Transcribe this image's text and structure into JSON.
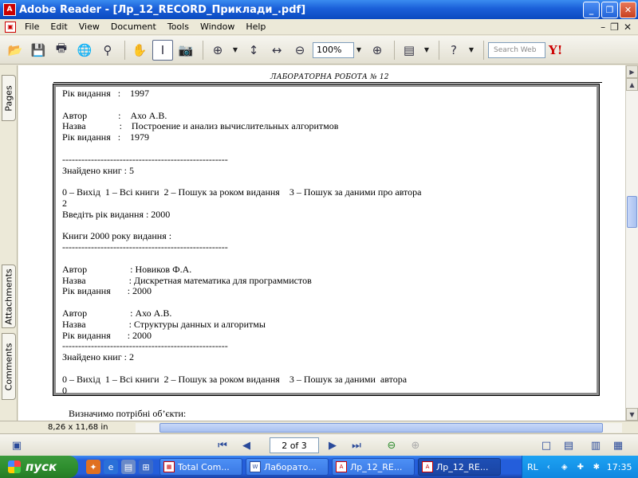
{
  "window": {
    "app_title": "Adobe Reader",
    "title_separator": " - ",
    "document_title": "[Лр_12_RECORD_Приклади_.pdf]",
    "min_label": "_",
    "max_label": "❐",
    "close_label": "✕"
  },
  "menu": {
    "items": [
      "File",
      "Edit",
      "View",
      "Document",
      "Tools",
      "Window",
      "Help"
    ]
  },
  "toolbar": {
    "zoom_value": "100%",
    "search_placeholder": "Search Web",
    "yahoo_label": "Y!"
  },
  "nav_pane": {
    "tabs": [
      "Pages",
      "Attachments",
      "Comments"
    ]
  },
  "document": {
    "page_header": "ЛАБОРАТОРНА РОБОТА № 12",
    "console_lines": [
      "Рік видання   :    1997",
      "",
      "Автор             :    Ахо А.В.",
      "Назва              :    Построение и анализ вычислительных алгоритмов",
      "Рік видання   :    1979",
      "",
      "----------------------------------------------------",
      "Знайдено книг : 5",
      "",
      "0 – Вихід  1 – Всі книги  2 – Пошук за роком видання    3 – Пошук за даними про автора",
      "2",
      "Введіть рік видання : 2000",
      "",
      "Книги 2000 року видання :",
      "----------------------------------------------------",
      "",
      "Автор                  : Новиков Ф.А.",
      "Назва                  : Дискретная математика для программистов",
      "Рік видання       : 2000",
      "",
      "Автор                  : Ахо А.В.",
      "Назва                  : Структуры данных и алгоритмы",
      "Рік видання       : 2000",
      "----------------------------------------------------",
      "Знайдено книг : 2",
      "",
      "0 – Вихід  1 – Всі книги  2 – Пошук за роком видання    3 – Пошук за даними  автора",
      "0"
    ],
    "body_text": "Визначимо потрібні об’єкти:"
  },
  "status": {
    "page_size": "8,26 x 11,68 in",
    "page_field": "2 of 3"
  },
  "taskbar": {
    "start_label": "пуск",
    "tasks": [
      {
        "label": "Total Com..."
      },
      {
        "label": "Лаборато..."
      },
      {
        "label": "Лр_12_RE..."
      },
      {
        "label": "Лр_12_RE..."
      }
    ],
    "lang": "RL",
    "clock": "17:35"
  }
}
